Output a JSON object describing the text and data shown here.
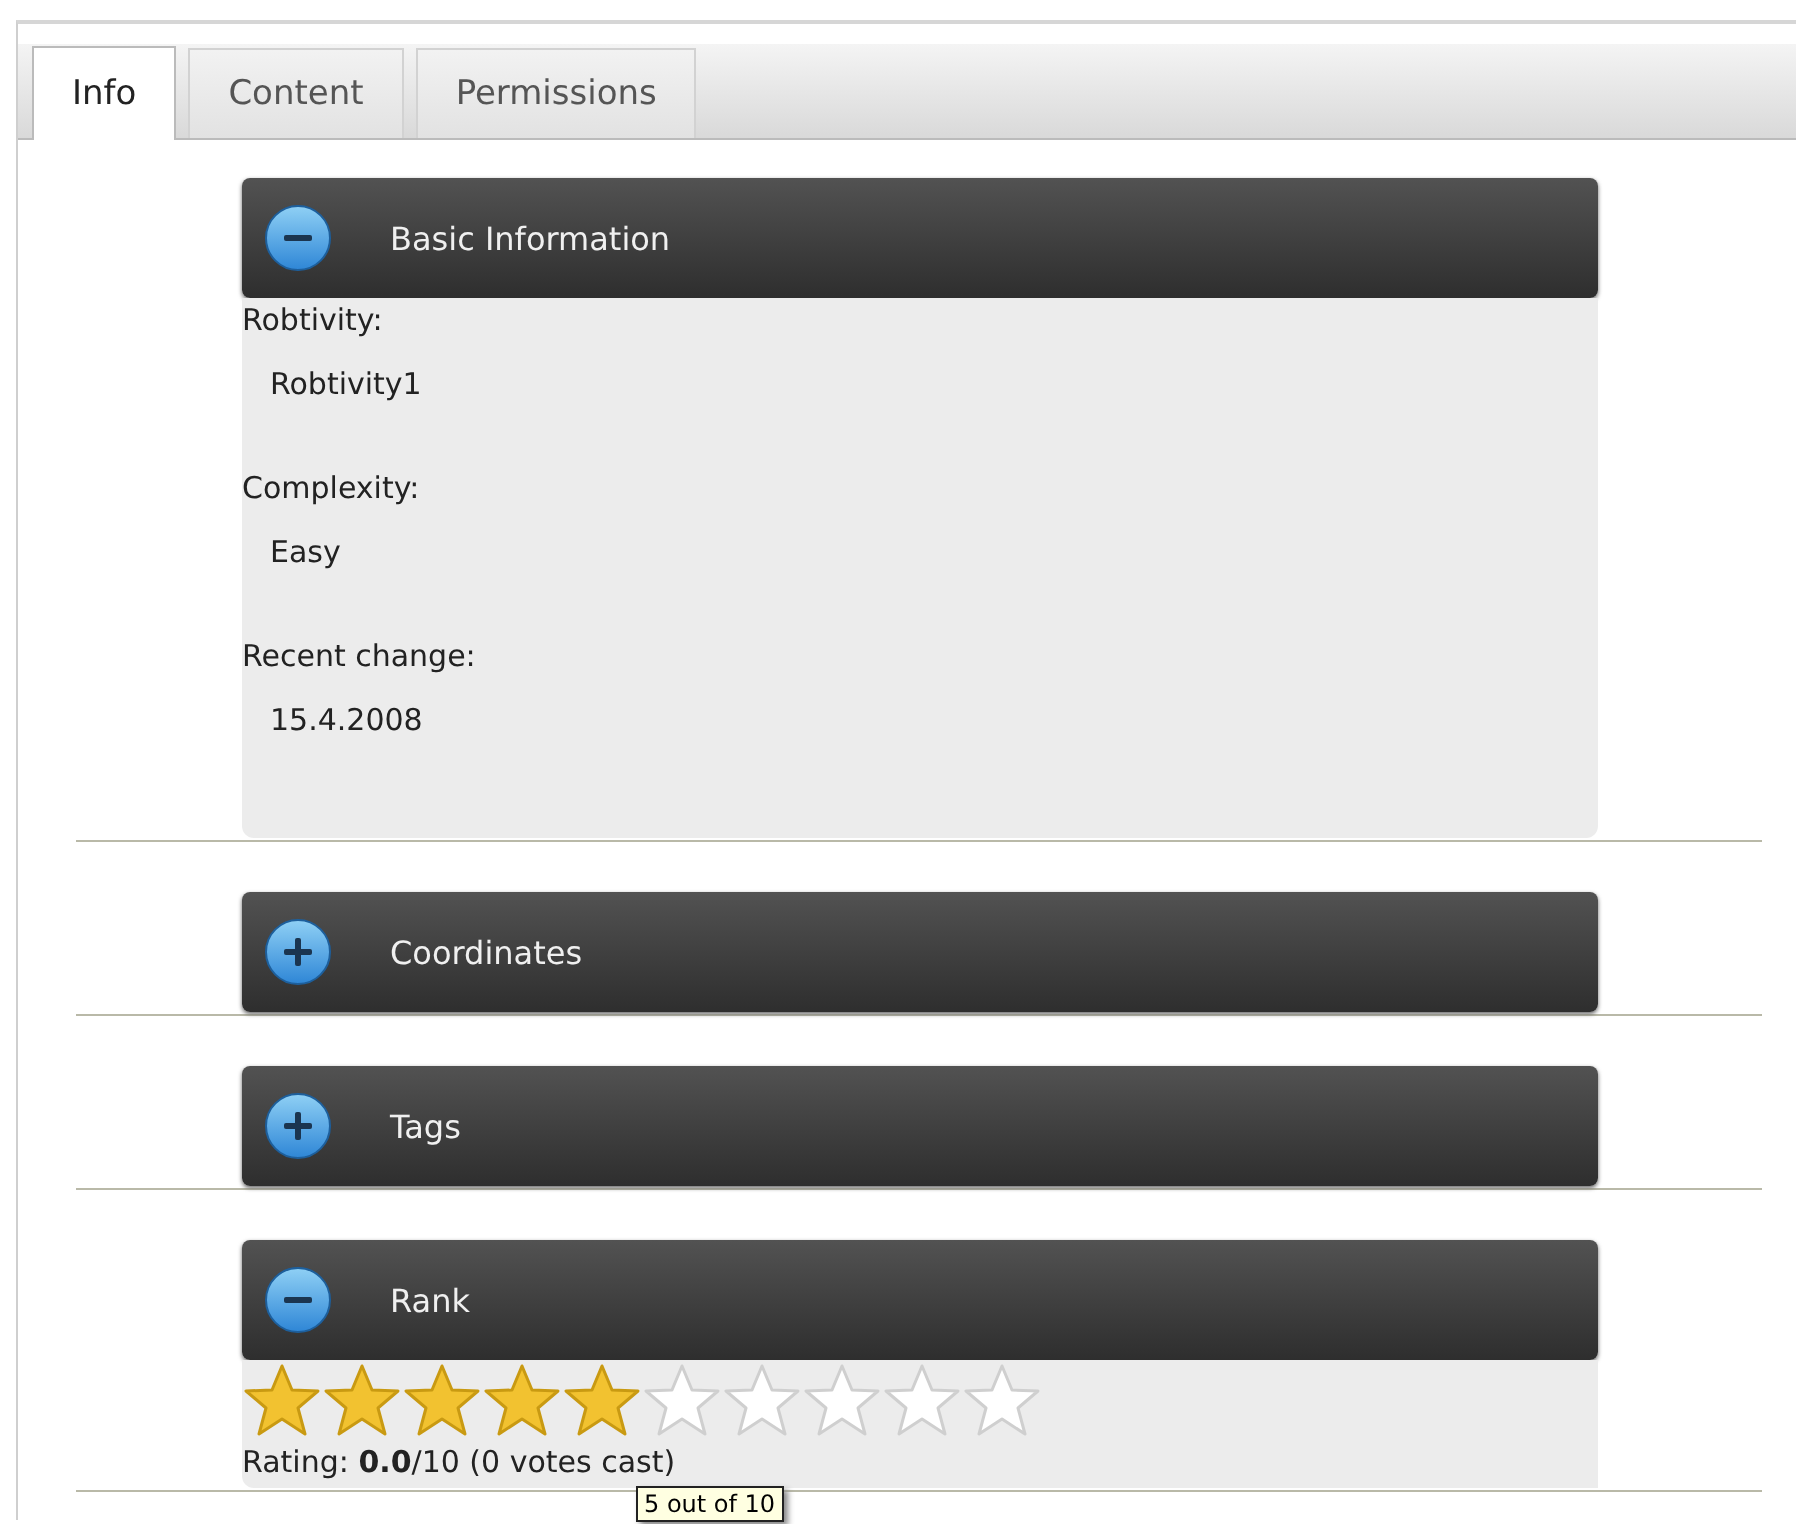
{
  "tabs": [
    {
      "label": "Info",
      "selected": true
    },
    {
      "label": "Content",
      "selected": false
    },
    {
      "label": "Permissions",
      "selected": false
    }
  ],
  "sections": [
    {
      "title": "Basic Information",
      "expanded": true,
      "kind": "fields",
      "fields": [
        {
          "label": "Robtivity:",
          "value": "Robtivity1"
        },
        {
          "label": "Complexity:",
          "value": "Easy"
        },
        {
          "label": "Recent change:",
          "value": "15.4.2008"
        }
      ]
    },
    {
      "title": "Coordinates",
      "expanded": false
    },
    {
      "title": "Tags",
      "expanded": false
    },
    {
      "title": "Rank",
      "expanded": true,
      "kind": "rating",
      "stars": 5,
      "rating_text": "Rating: **0.0**/10 (0 votes cast)",
      "tooltip": "5 out of 10"
    }
  ]
}
